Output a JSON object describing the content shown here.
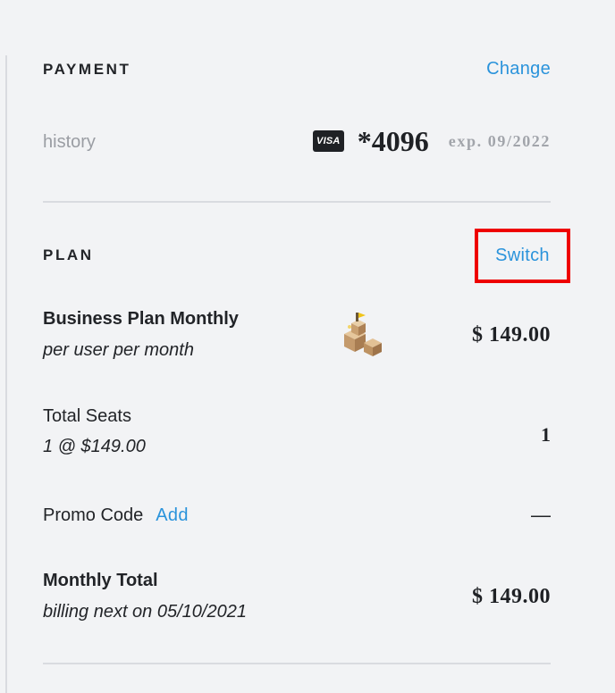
{
  "payment": {
    "heading": "PAYMENT",
    "change_label": "Change",
    "history_label": "history",
    "card_brand": "VISA",
    "card_last4": "*4096",
    "card_expiry": "exp. 09/2022"
  },
  "plan": {
    "heading": "PLAN",
    "switch_label": "Switch",
    "name": "Business Plan Monthly",
    "billing_unit": "per user per month",
    "price": "$ 149.00",
    "seats_label": "Total Seats",
    "seats_detail": "1 @ $149.00",
    "seats_count": "1",
    "promo_label": "Promo Code",
    "promo_add_label": "Add",
    "promo_value": "—",
    "total_label": "Monthly Total",
    "total_detail": "billing next on 05/10/2021",
    "total_price": "$ 149.00"
  },
  "colors": {
    "background": "#f2f3f5",
    "link": "#2a93db",
    "highlight_box": "#ee0000",
    "text": "#222428",
    "muted": "#9a9da3"
  },
  "icons": {
    "card": "visa-card-icon",
    "plan": "building-blocks-icon"
  }
}
